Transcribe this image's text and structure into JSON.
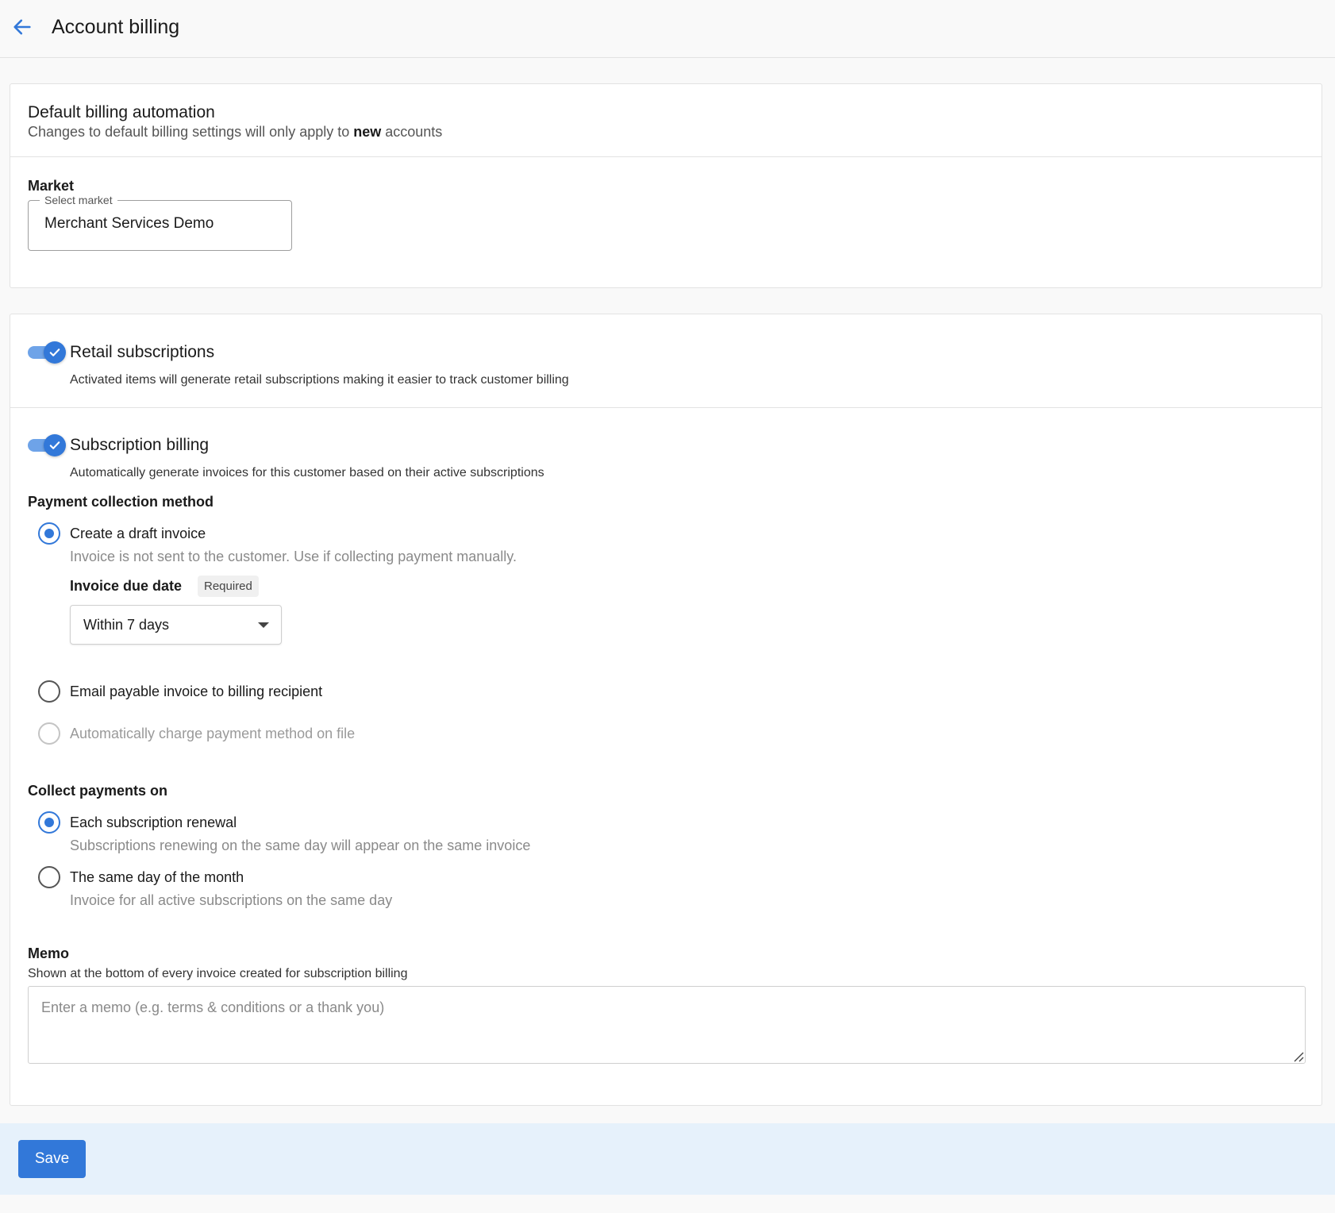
{
  "header": {
    "title": "Account billing",
    "back_icon": "arrow-left-icon"
  },
  "default_billing": {
    "title": "Default billing automation",
    "subtitle_prefix": "Changes to default billing settings will only apply to ",
    "subtitle_bold": "new",
    "subtitle_suffix": " accounts",
    "market_label": "Market",
    "market_legend": "Select market",
    "market_value": "Merchant Services Demo"
  },
  "retail": {
    "enabled": true,
    "title": "Retail subscriptions",
    "description": "Activated items will generate retail subscriptions making it easier to track customer billing"
  },
  "subscription_billing": {
    "enabled": true,
    "title": "Subscription billing",
    "description": "Automatically generate invoices for this customer based on their active subscriptions",
    "payment_method_label": "Payment collection method",
    "payment_options": [
      {
        "label": "Create a draft invoice",
        "help": "Invoice is not sent to the customer. Use if collecting payment manually.",
        "checked": true,
        "disabled": false
      },
      {
        "label": "Email payable invoice to billing recipient",
        "checked": false,
        "disabled": false
      },
      {
        "label": "Automatically charge payment method on file",
        "checked": false,
        "disabled": true
      }
    ],
    "due_date_label": "Invoice due date",
    "due_date_required": "Required",
    "due_date_value": "Within 7 days",
    "collect_label": "Collect payments on",
    "collect_options": [
      {
        "label": "Each subscription renewal",
        "help": "Subscriptions renewing on the same day will appear on the same invoice",
        "checked": true
      },
      {
        "label": "The same day of the month",
        "help": "Invoice for all active subscriptions on the same day",
        "checked": false
      }
    ],
    "memo_label": "Memo",
    "memo_help": "Shown at the bottom of every invoice created for subscription billing",
    "memo_placeholder": "Enter a memo (e.g. terms & conditions or a thank you)",
    "memo_value": ""
  },
  "footer": {
    "save_label": "Save"
  },
  "colors": {
    "accent": "#3278d9",
    "footer_bg": "#e6f1fb"
  }
}
